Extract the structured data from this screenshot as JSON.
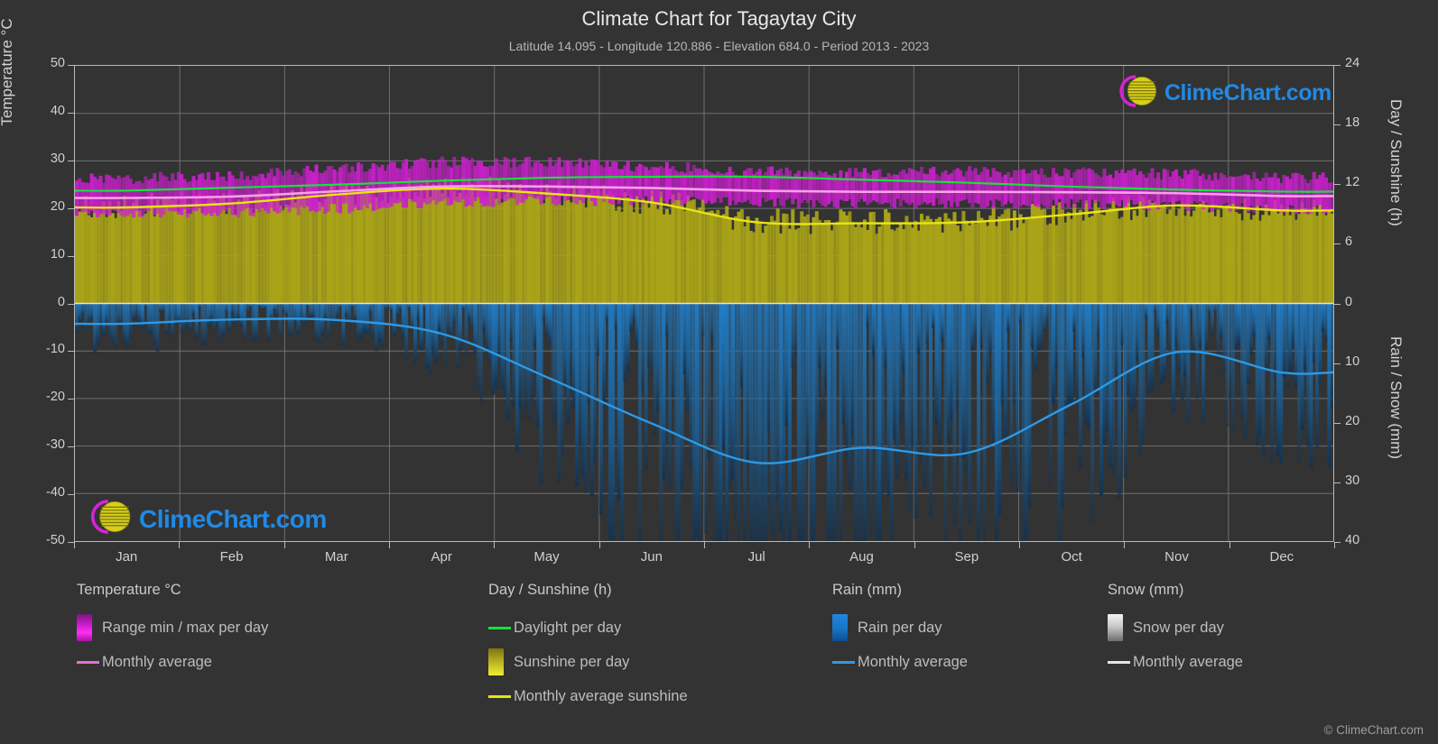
{
  "header": {
    "title": "Climate Chart for Tagaytay City",
    "subtitle": "Latitude 14.095 - Longitude 120.886 - Elevation 684.0 - Period 2013 - 2023"
  },
  "branding": {
    "logo_text": "ClimeChart.com",
    "copyright": "© ClimeChart.com",
    "logo_text_color": "#1f8ae8",
    "logo_arc_color": "#d424d4",
    "logo_sphere_color": "#d8d018"
  },
  "axes": {
    "left": {
      "label": "Temperature °C",
      "ticks": [
        "50",
        "40",
        "30",
        "20",
        "10",
        "0",
        "-10",
        "-20",
        "-30",
        "-40",
        "-50"
      ],
      "min": -50,
      "max": 50,
      "step": 10
    },
    "right_top": {
      "label": "Day / Sunshine (h)",
      "ticks": [
        "24",
        "18",
        "12",
        "6",
        "0"
      ],
      "min": 0,
      "max": 24,
      "step": 6
    },
    "right_bottom": {
      "label": "Rain / Snow (mm)",
      "ticks": [
        "0",
        "10",
        "20",
        "30",
        "40"
      ],
      "min": 0,
      "max": 40,
      "step": 10
    },
    "x": {
      "ticks": [
        "Jan",
        "Feb",
        "Mar",
        "Apr",
        "May",
        "Jun",
        "Jul",
        "Aug",
        "Sep",
        "Oct",
        "Nov",
        "Dec"
      ]
    }
  },
  "legend": {
    "columns": [
      {
        "heading": "Temperature °C",
        "entries": [
          {
            "label": "Range min / max per day",
            "marker": "band",
            "style": "sw-temp"
          },
          {
            "label": "Monthly average",
            "marker": "line",
            "style": "ls-pink"
          }
        ]
      },
      {
        "heading": "Day / Sunshine (h)",
        "entries": [
          {
            "label": "Daylight per day",
            "marker": "line",
            "style": "ls-green"
          },
          {
            "label": "Sunshine per day",
            "marker": "band",
            "style": "sw-sun"
          },
          {
            "label": "Monthly average sunshine",
            "marker": "line",
            "style": "ls-yellow"
          }
        ]
      },
      {
        "heading": "Rain (mm)",
        "entries": [
          {
            "label": "Rain per day",
            "marker": "band",
            "style": "sw-rain"
          },
          {
            "label": "Monthly average",
            "marker": "line",
            "style": "ls-blue"
          }
        ]
      },
      {
        "heading": "Snow (mm)",
        "entries": [
          {
            "label": "Snow per day",
            "marker": "band",
            "style": "sw-snow"
          },
          {
            "label": "Monthly average",
            "marker": "line",
            "style": "ls-white"
          }
        ]
      }
    ]
  },
  "colors": {
    "background": "#333333",
    "plot_frame": "#b9b9b9",
    "grid": "#6e6e6e",
    "temp_band": "#cc1fce",
    "temp_avg_line": "#f06ad4",
    "daylight_line": "#18e23a",
    "sunshine_fill": "#a9a318",
    "sunshine_avg_line": "#e8e413",
    "rain_fill": "#1a6ba8",
    "rain_avg_line": "#2e9ae6",
    "snow_fill": "#c9c9c9"
  },
  "chart_data": {
    "type": "area",
    "title": "Climate Chart for Tagaytay City",
    "subtitle": "Latitude 14.095 - Longitude 120.886 - Elevation 684.0 - Period 2013 - 2023",
    "xlabel": "",
    "ylabel": "Temperature °C",
    "ylabel_right_top": "Day / Sunshine (h)",
    "ylabel_right_bottom": "Rain / Snow (mm)",
    "ylim": [
      -50,
      50
    ],
    "ylim_right_top": [
      0,
      24
    ],
    "ylim_right_bottom": [
      0,
      40
    ],
    "grid": true,
    "legend_position": "below",
    "categories": [
      "Jan",
      "Feb",
      "Mar",
      "Apr",
      "May",
      "Jun",
      "Jul",
      "Aug",
      "Sep",
      "Oct",
      "Nov",
      "Dec"
    ],
    "series": [
      {
        "name": "Monthly average temperature",
        "unit": "°C",
        "axis": "left",
        "color": "#f06ad4",
        "values": [
          22.2,
          22.5,
          23.6,
          24.6,
          24.6,
          24.3,
          23.7,
          23.5,
          23.5,
          23.4,
          23.2,
          22.6
        ]
      },
      {
        "name": "Daily temperature range max",
        "unit": "°C",
        "axis": "left",
        "color": "#cc1fce",
        "values": [
          26.0,
          26.6,
          28.0,
          29.4,
          29.3,
          28.5,
          27.4,
          27.2,
          27.3,
          27.2,
          26.9,
          26.1
        ]
      },
      {
        "name": "Daily temperature range min",
        "unit": "°C",
        "axis": "left",
        "color": "#cc1fce",
        "values": [
          19.4,
          19.4,
          20.3,
          21.5,
          22.0,
          21.9,
          21.5,
          21.3,
          21.4,
          21.2,
          20.9,
          20.1
        ]
      },
      {
        "name": "Daylight per day",
        "unit": "h",
        "axis": "right_top",
        "color": "#18e23a",
        "values": [
          11.4,
          11.7,
          12.0,
          12.4,
          12.7,
          12.8,
          12.8,
          12.5,
          12.2,
          11.8,
          11.5,
          11.3
        ]
      },
      {
        "name": "Monthly average sunshine",
        "unit": "h",
        "axis": "right_top",
        "color": "#e8e413",
        "values": [
          9.7,
          10.1,
          11.0,
          11.6,
          11.1,
          10.2,
          8.2,
          8.1,
          8.2,
          9.0,
          9.9,
          9.4
        ]
      },
      {
        "name": "Rain monthly average",
        "unit": "mm",
        "axis": "right_bottom",
        "color": "#2e9ae6",
        "values": [
          3.4,
          2.7,
          2.8,
          5.1,
          12.4,
          20.2,
          26.8,
          24.3,
          25.2,
          17.0,
          8.2,
          11.6
        ]
      },
      {
        "name": "Snow monthly average",
        "unit": "mm",
        "axis": "right_bottom",
        "color": "#e4e4e4",
        "values": [
          0,
          0,
          0,
          0,
          0,
          0,
          0,
          0,
          0,
          0,
          0,
          0
        ]
      }
    ]
  }
}
